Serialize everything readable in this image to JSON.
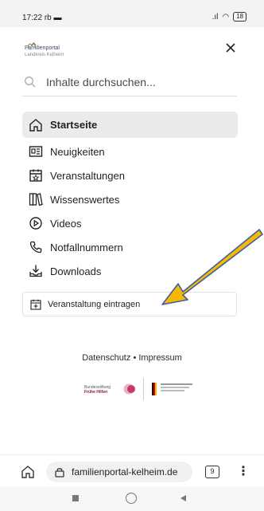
{
  "status": {
    "time": "17:22",
    "time_suffix": "rb",
    "battery": "18"
  },
  "logo": {
    "name": "Familienportal",
    "sub": "Landkreis Kelheim"
  },
  "search": {
    "placeholder": "Inhalte durchsuchen..."
  },
  "nav": {
    "items": [
      {
        "label": "Startseite",
        "icon": "home-icon"
      },
      {
        "label": "Neuigkeiten",
        "icon": "newspaper-icon"
      },
      {
        "label": "Veranstaltungen",
        "icon": "calendar-icon"
      },
      {
        "label": "Wissenswertes",
        "icon": "books-icon"
      },
      {
        "label": "Videos",
        "icon": "play-icon"
      },
      {
        "label": "Notfallnummern",
        "icon": "phone-icon"
      },
      {
        "label": "Downloads",
        "icon": "download-icon"
      }
    ],
    "event_button": "Veranstaltung eintragen"
  },
  "footer": {
    "privacy": "Datenschutz",
    "separator": "•",
    "imprint": "Impressum"
  },
  "partners": {
    "p1_line1": "Bundesstiftung",
    "p1_line2": "Frühe Hilfen"
  },
  "browser": {
    "url": "familienportal-kelheim.de",
    "tab_count": "9"
  },
  "colors": {
    "accent_arrow": "#f6b800",
    "active_bg": "#ebebeb"
  }
}
